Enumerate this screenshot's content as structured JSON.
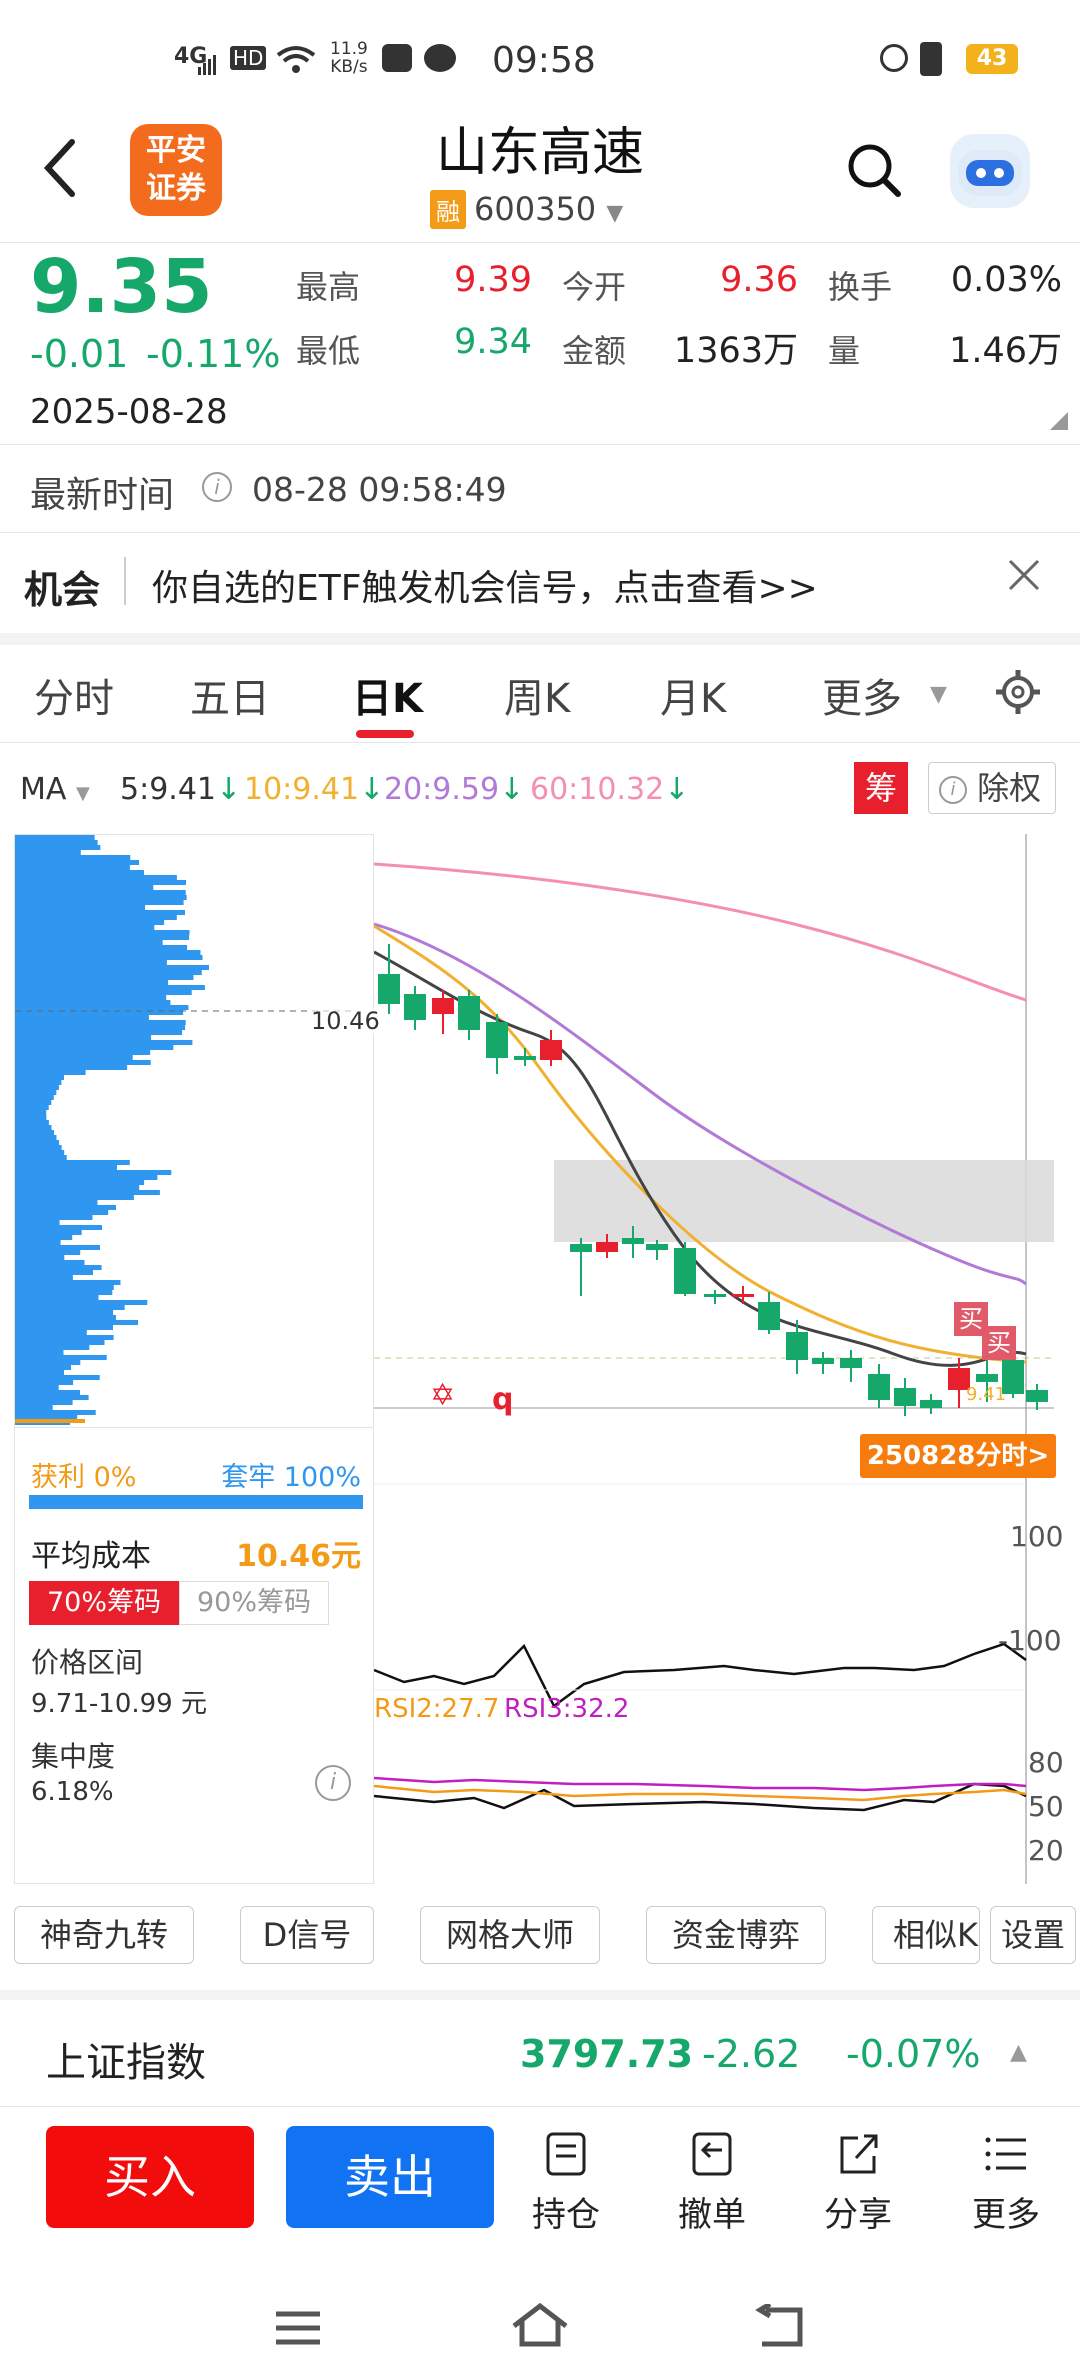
{
  "status": {
    "network": "4G",
    "hd": "HD",
    "speed_value": "11.9",
    "speed_unit": "KB/s",
    "time": "09:58",
    "battery": "43"
  },
  "header": {
    "title": "山东高速",
    "code": "600350",
    "rong_badge": "融",
    "logo_line1": "平安",
    "logo_line2": "证券"
  },
  "quote": {
    "price": "9.35",
    "change": "-0.01",
    "change_pct": "-0.11%",
    "date": "2025-08-28",
    "high_label": "最高",
    "high": "9.39",
    "low_label": "最低",
    "low": "9.34",
    "open_label": "今开",
    "open": "9.36",
    "amount_label": "金额",
    "amount": "1363万",
    "turnover_label": "换手",
    "turnover": "0.03%",
    "volume_label": "量",
    "volume": "1.46万"
  },
  "update": {
    "label": "最新时间",
    "time": "08-28 09:58:49"
  },
  "notice": {
    "tag": "机会",
    "text": "你自选的ETF触发机会信号，点击查看>>"
  },
  "tabs": [
    "分时",
    "五日",
    "日K",
    "周K",
    "月K",
    "更多"
  ],
  "ma": {
    "label": "MA",
    "ma5": "5:9.41",
    "ma10": "10:9.41",
    "ma20": "20:9.59",
    "ma60": "60:10.32",
    "chou_badge": "筹",
    "chuquan": "除权"
  },
  "chip": {
    "profit_label": "获利 0%",
    "trapped_label": "套牢 100%",
    "avg_cost_label": "平均成本",
    "avg_cost": "10.46元",
    "tab70": "70%筹码",
    "tab90": "90%筹码",
    "range_label": "价格区间",
    "range": "9.71-10.99 元",
    "conc_label": "集中度",
    "conc": "6.18%",
    "price_marker": "10.46"
  },
  "chart": {
    "fenshi_label": "250828分时>",
    "buy_label": "买",
    "cci_top": "100",
    "cci_bottom": "-100",
    "rsi2": "RSI2:27.7",
    "rsi3": "RSI3:32.2",
    "rsi_80": "80",
    "rsi_50": "50",
    "rsi_20": "20",
    "marker_q": "q",
    "mini_label": "9.41"
  },
  "tools": [
    "神奇九转",
    "D信号",
    "网格大师",
    "资金博弈",
    "相似K",
    "设置"
  ],
  "index": {
    "name": "上证指数",
    "value": "3797.73",
    "change": "-2.62",
    "pct": "-0.07%"
  },
  "actions": {
    "buy": "买入",
    "sell": "卖出",
    "hold": "持仓",
    "cancel": "撤单",
    "share": "分享",
    "more": "更多"
  },
  "colors": {
    "up": "#e8202e",
    "down": "#15a86a",
    "ma5": "#444444",
    "ma10": "#f0b030",
    "ma20": "#b27ad6",
    "ma60": "#f48fb1",
    "chip": "#2f97f0",
    "buy_btn": "#f30c0c",
    "sell_btn": "#1173f3"
  }
}
